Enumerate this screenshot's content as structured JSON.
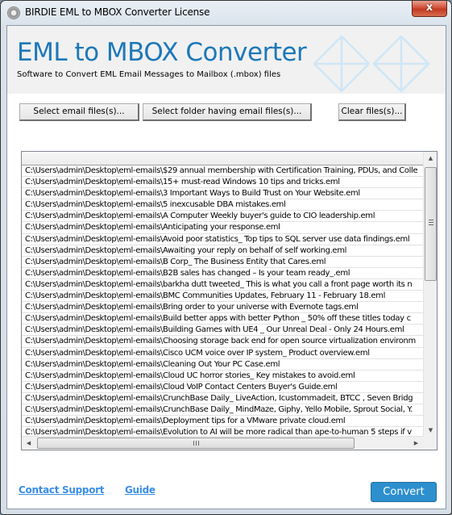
{
  "window": {
    "title": "BIRDIE EML to MBOX Converter License",
    "close_label": "x"
  },
  "banner": {
    "heading": "EML to MBOX Converter",
    "subheading": "Software to Convert EML Email Messages to Mailbox (.mbox) files",
    "icons": [
      "envelope-icon",
      "envelope-icon"
    ],
    "accent_color": "#1d78b8"
  },
  "toolbar": {
    "select_files_label": "Select email files(s)...",
    "select_folder_label": "Select folder having email files(s)...",
    "clear_files_label": "Clear files(s)..."
  },
  "file_list": {
    "header": "",
    "rows": [
      "C:\\Users\\admin\\Desktop\\eml-emails\\$29 annual membership with Certification Training, PDUs, and Colle",
      "C:\\Users\\admin\\Desktop\\eml-emails\\15+ must-read Windows 10 tips and tricks.eml",
      "C:\\Users\\admin\\Desktop\\eml-emails\\3 Important Ways to Build Trust on Your Website.eml",
      "C:\\Users\\admin\\Desktop\\eml-emails\\5 inexcusable DBA mistakes.eml",
      "C:\\Users\\admin\\Desktop\\eml-emails\\A Computer Weekly buyer's guide to CIO leadership.eml",
      "C:\\Users\\admin\\Desktop\\eml-emails\\Anticipating your response.eml",
      "C:\\Users\\admin\\Desktop\\eml-emails\\Avoid poor statistics_ Top tips to SQL server use data findings.eml",
      "C:\\Users\\admin\\Desktop\\eml-emails\\Awaiting your reply on behalf of self working.eml",
      "C:\\Users\\admin\\Desktop\\eml-emails\\B Corp_ The Business Entity that Cares.eml",
      "C:\\Users\\admin\\Desktop\\eml-emails\\B2B sales has changed – Is your team ready_.eml",
      "C:\\Users\\admin\\Desktop\\eml-emails\\barkha dutt tweeted_ This is what you call a front page worth its n",
      "C:\\Users\\admin\\Desktop\\eml-emails\\BMC Communities Updates, February 11 - February 18.eml",
      "C:\\Users\\admin\\Desktop\\eml-emails\\Bring order to your universe with Evernote tags.eml",
      "C:\\Users\\admin\\Desktop\\eml-emails\\Build better apps with better Python _ 50% off these titles today c",
      "C:\\Users\\admin\\Desktop\\eml-emails\\Building Games with UE4 _ Our Unreal Deal - Only 24 Hours.eml",
      "C:\\Users\\admin\\Desktop\\eml-emails\\Choosing storage back end for open source virtualization environm",
      "C:\\Users\\admin\\Desktop\\eml-emails\\Cisco UCM voice over IP system_ Product overview.eml",
      "C:\\Users\\admin\\Desktop\\eml-emails\\Cleaning Out Your PC Case.eml",
      "C:\\Users\\admin\\Desktop\\eml-emails\\Cloud UC horror stories_ Key mistakes to avoid.eml",
      "C:\\Users\\admin\\Desktop\\eml-emails\\Cloud VoIP Contact Centers Buyer's Guide.eml",
      "C:\\Users\\admin\\Desktop\\eml-emails\\CrunchBase Daily_  LiveAction, Icustommadeit, BTCC , Seven Bridg",
      "C:\\Users\\admin\\Desktop\\eml-emails\\CrunchBase Daily_ MindMaze, Giphy, Yello Mobile, Sprout Social, Y.",
      "C:\\Users\\admin\\Desktop\\eml-emails\\Deployment tips for a VMware private cloud.eml",
      "C:\\Users\\admin\\Desktop\\eml-emails\\Evolution to AI will be more radical than ape-to-human   5 steps if v"
    ],
    "scroll_icons": {
      "up": "▲",
      "down": "▼",
      "left": "◀",
      "right": "▶"
    }
  },
  "footer": {
    "contact_support_label": "Contact Support",
    "guide_label": "Guide",
    "convert_label": "Convert",
    "link_color": "#3a8ee6",
    "convert_color": "#2d8fcd"
  }
}
